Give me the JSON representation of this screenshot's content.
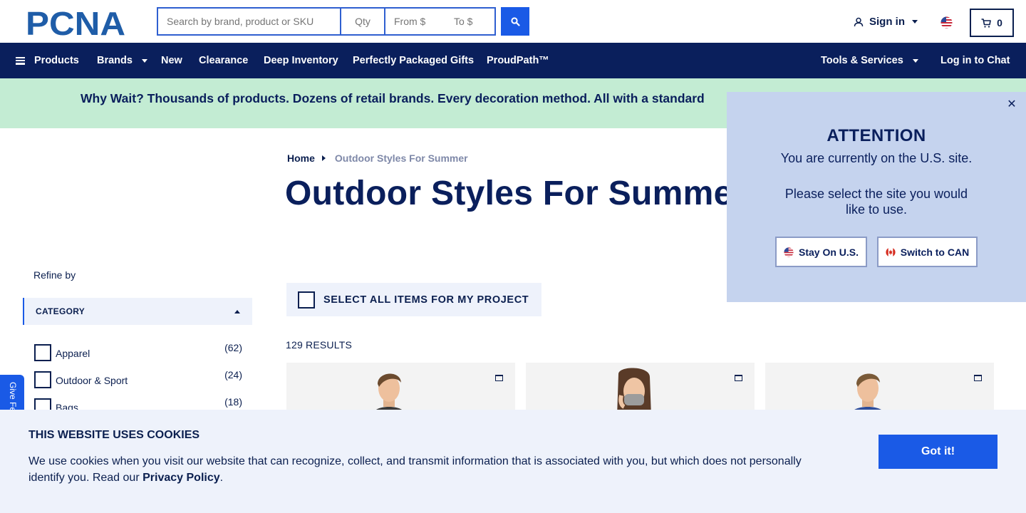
{
  "brand": {
    "logo_text": "PCNA"
  },
  "search": {
    "placeholder": "Search by brand, product or SKU",
    "qty_placeholder": "Qty",
    "from_placeholder": "From $",
    "to_placeholder": "To $"
  },
  "header": {
    "signin_label": "Sign in",
    "cart_count": "0"
  },
  "nav": {
    "products": "Products",
    "brands": "Brands",
    "new": "New",
    "clearance": "Clearance",
    "deep_inventory": "Deep Inventory",
    "gifts": "Perfectly Packaged Gifts",
    "proudpath": "ProudPath™",
    "tools": "Tools & Services",
    "chat": "Log in to Chat"
  },
  "promo": {
    "text": "Why Wait? Thousands of products. Dozens of retail brands. Every decoration method. All with a standard"
  },
  "breadcrumb": {
    "home": "Home",
    "current": "Outdoor Styles For Summer"
  },
  "page": {
    "title": "Outdoor Styles For Summer"
  },
  "sidebar": {
    "refine_label": "Refine by",
    "category_header": "CATEGORY",
    "categories": [
      {
        "name": "Apparel",
        "count": "(62)"
      },
      {
        "name": "Outdoor & Sport",
        "count": "(24)"
      },
      {
        "name": "Bags",
        "count": "(18)"
      }
    ]
  },
  "feedback": {
    "label": "Give Feedback"
  },
  "results": {
    "select_all": "SELECT ALL ITEMS FOR MY PROJECT",
    "count_label": "129 RESULTS"
  },
  "attention": {
    "title": "ATTENTION",
    "line1": "You are currently on the U.S. site.",
    "line2": "Please select the site you would like to use.",
    "stay_label": "Stay On U.S.",
    "switch_label": "Switch to CAN"
  },
  "cookie": {
    "title": "THIS WEBSITE USES COOKIES",
    "text": "We use cookies when you visit our website that can recognize, collect, and transmit information that is associated with you, but which does not personally identify you. Read our",
    "link": "Privacy Policy",
    "period": ".",
    "button": "Got it!"
  },
  "colors": {
    "navy": "#0a1f5c",
    "accent_blue": "#1a5ae6",
    "promo_green": "#c3ecd3",
    "modal_bg": "#c5d3ee",
    "light_panel": "#eef2fb"
  },
  "icons": [
    "search-icon",
    "user-icon",
    "us-flag-icon",
    "cart-icon",
    "hamburger-icon",
    "close-icon",
    "folder-icon",
    "canada-flag-icon"
  ]
}
